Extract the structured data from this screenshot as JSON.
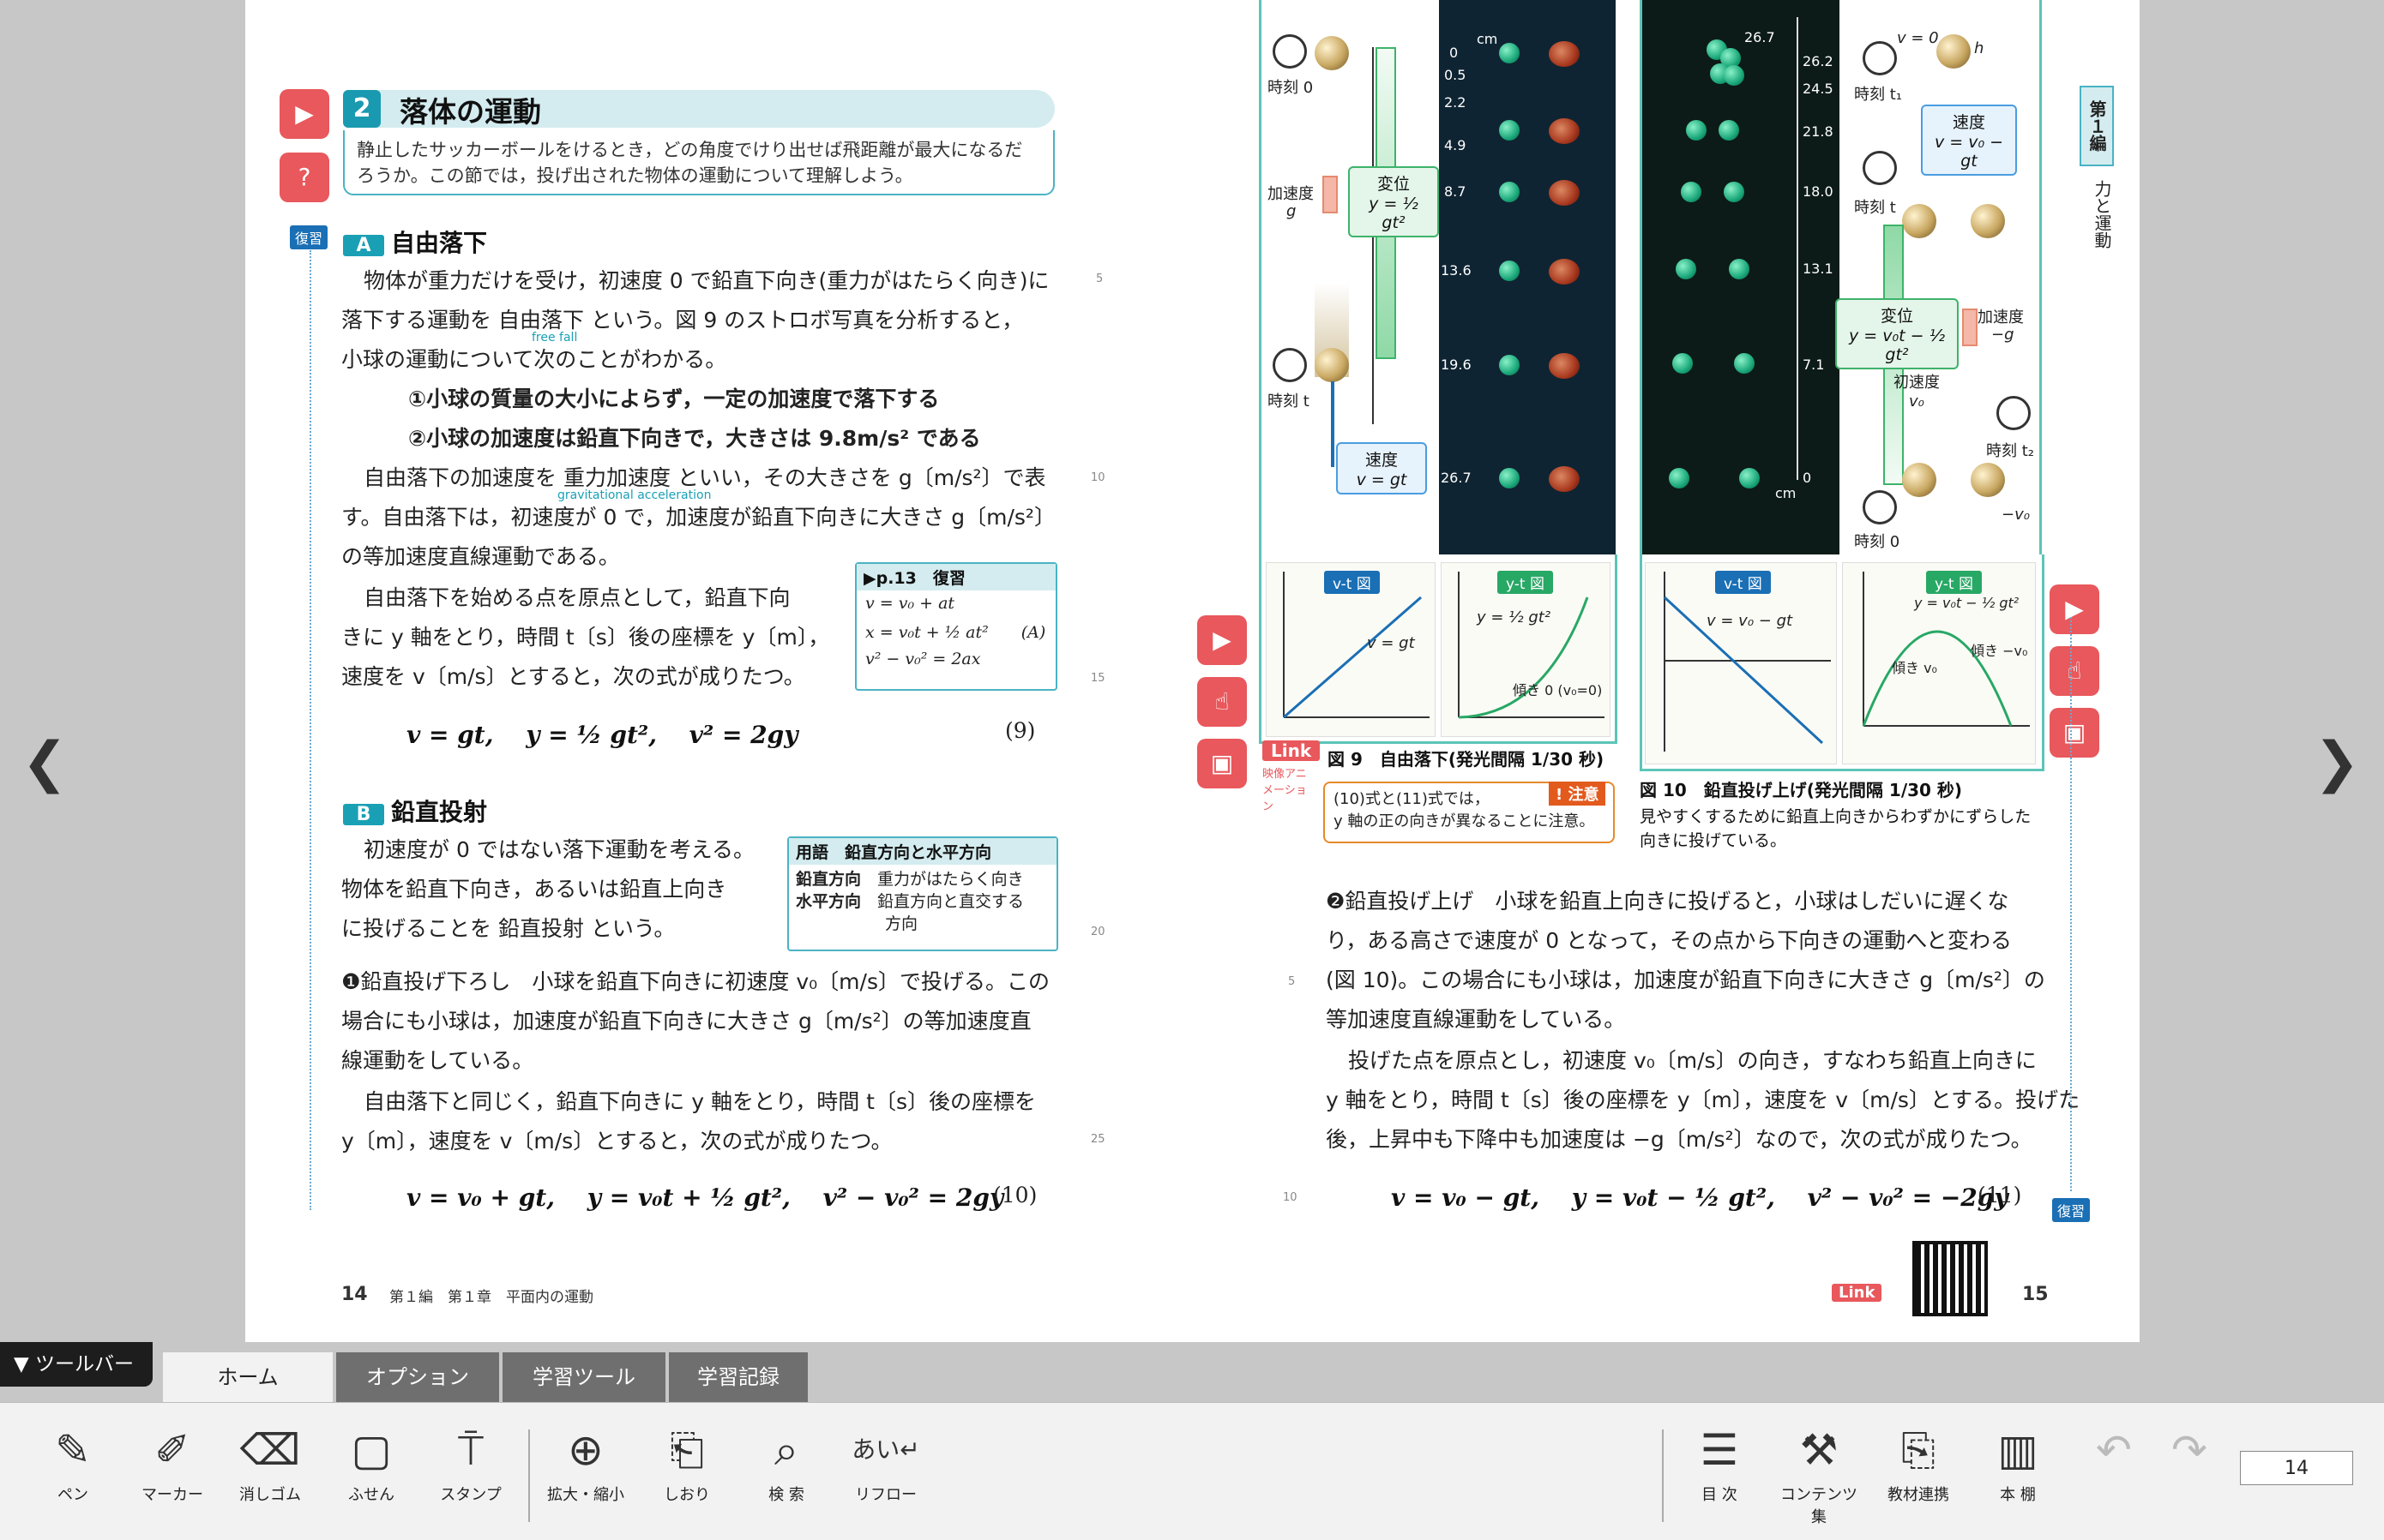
{
  "left_page": {
    "section_number": "2",
    "section_title": "落体の運動",
    "intro": [
      "静止したサッカーボールをけるとき，どの角度でけり出せば飛距離が最大になるだ",
      "ろうか。この節では，投げ出された物体の運動について理解しよう。"
    ],
    "review_tag": "復習",
    "subA_badge": "A",
    "subA_title": "自由落下",
    "paraA": [
      "物体が重力だけを受け，初速度 0 で鉛直下向き(重力がはたらく向き)に",
      "落下する運動を 自由落下 という。図 9 のストロボ写真を分析すると，",
      "小球の運動について次のことがわかる。",
      "①小球の質量の大小によらず，一定の加速度で落下する",
      "②小球の加速度は鉛直下向きで，大きさは 9.8m/s² である",
      "自由落下の加速度を 重力加速度 といい，その大きさを g〔m/s²〕で表",
      "す。自由落下は，初速度が 0 で，加速度が鉛直下向きに大きさ g〔m/s²〕",
      "の等加速度直線運動である。",
      "自由落下を始める点を原点として，鉛直下向",
      "きに y 軸をとり，時間 t〔s〕後の座標を y〔m〕，",
      "速度を v〔m/s〕とすると，次の式が成りたつ。"
    ],
    "ruby_free_fall": "free fall",
    "ruby_grav": "gravitational acceleration",
    "review_box": {
      "head": "▶p.13　復習",
      "l1": "v = v₀ + at",
      "l2": "x = v₀t + ½ at²　　(A)",
      "l3": "v² − v₀² = 2ax"
    },
    "eq9": "v = gt,　 y = ½ gt²,　 v² = 2gy",
    "eq9_num": "(9)",
    "subB_badge": "B",
    "subB_title": "鉛直投射",
    "paraB": [
      "初速度が 0 ではない落下運動を考える。",
      "物体を鉛直下向き，あるいは鉛直上向き",
      "に投げることを 鉛直投射 という。"
    ],
    "term_box": {
      "head": "用語　鉛直方向と水平方向",
      "r1a": "鉛直方向",
      "r1b": "重力がはたらく向き",
      "r2a": "水平方向",
      "r2b": "鉛直方向と直交する",
      "r2c": "方向"
    },
    "para1": [
      "❶鉛直投げ下ろし　小球を鉛直下向きに初速度 v₀〔m/s〕で投げる。この",
      "場合にも小球は，加速度が鉛直下向きに大きさ g〔m/s²〕の等加速度直",
      "線運動をしている。",
      "自由落下と同じく，鉛直下向きに y 軸をとり，時間 t〔s〕後の座標を",
      "y〔m〕，速度を v〔m/s〕とすると，次の式が成りたつ。"
    ],
    "eq10": "v = v₀ + gt,　 y = v₀t + ½ gt²,　 v² − v₀² = 2gy",
    "eq10_num": "(10)",
    "line_numbers": [
      "5",
      "10",
      "15",
      "20",
      "25"
    ],
    "page_no": "14",
    "footer": "第１編　第１章　平面内の運動"
  },
  "right_page": {
    "fig9": {
      "time0": "時刻 0",
      "timet": "時刻 t",
      "accel": "加速度",
      "g": "g",
      "disp": "変位",
      "disp_eq": "y = ½ gt²",
      "vel": "速度",
      "vel_eq": "v = gt",
      "cm": "cm",
      "ticks": [
        "0",
        "0.5",
        "2.2",
        "4.9",
        "8.7",
        "13.6",
        "19.6",
        "26.7"
      ],
      "vt_label": "v-t 図",
      "vt_eq": "v = gt",
      "yt_label": "y-t 図",
      "yt_eq": "y = ½ gt²",
      "yt_note": "傾き 0 (v₀=0)",
      "caption": "図 9　自由落下(発光間隔 1/30 秒)"
    },
    "fig10": {
      "ticks": [
        "26.7",
        "26.2",
        "24.5",
        "21.8",
        "18.0",
        "13.1",
        "7.1",
        "0"
      ],
      "cm": "cm",
      "v0": "v = 0",
      "t1": "時刻 t₁",
      "tt": "時刻 t",
      "t2": "時刻 t₂",
      "t0": "時刻 0",
      "vel": "速度",
      "vel_eq": "v = v₀ − gt",
      "disp": "変位",
      "disp_eq": "y = v₀t − ½ gt²",
      "init": "初速度",
      "init_v": "v₀",
      "accel": "加速度",
      "accel_v": "−g",
      "neg_v0": "−v₀",
      "h": "h",
      "vt_label": "v-t 図",
      "vt_eq": "v = v₀ − gt",
      "yt_label": "y-t 図",
      "yt_eq": "y = v₀t − ½ gt²",
      "slope1": "傾き v₀",
      "slope2": "傾き −v₀",
      "caption": "図 10　鉛直投げ上げ(発光間隔 1/30 秒)",
      "caption_sub": [
        "見やすくするために鉛直上向きからわずかにずらした",
        "向きに投げている。"
      ]
    },
    "link_label": "Link",
    "link_sub": "映像アニメーション",
    "note": {
      "tag": "! 注意",
      "l1": "(10)式と(11)式では，",
      "l2": "y 軸の正の向きが異なることに注意。"
    },
    "para2": [
      "❷鉛直投げ上げ　小球を鉛直上向きに投げると，小球はしだいに遅くな",
      "り，ある高さで速度が 0 となって，その点から下向きの運動へと変わる",
      "(図 10)。この場合にも小球は，加速度が鉛直下向きに大きさ g〔m/s²〕の",
      "等加速度直線運動をしている。",
      "投げた点を原点とし，初速度 v₀〔m/s〕の向き，すなわち鉛直上向きに",
      "y 軸をとり，時間 t〔s〕後の座標を y〔m〕，速度を v〔m/s〕とする。投げた",
      "後，上昇中も下降中も加速度は −g〔m/s²〕なので，次の式が成りたつ。"
    ],
    "eq11": "v = v₀ − gt,　 y = v₀t − ½ gt²,　 v² − v₀² = −2gy",
    "eq11_num": "(11)",
    "line_numbers": [
      "5",
      "10"
    ],
    "review_tag": "復習",
    "chapter_tab": "第１編",
    "chapter_side": "力と運動",
    "page_no": "15"
  },
  "toolbar": {
    "toggle": "▼ ツールバー",
    "tabs": [
      "ホーム",
      "オプション",
      "学習ツール",
      "学習記録"
    ],
    "tools_left": [
      "ペン",
      "マーカー",
      "消しゴム",
      "ふせん",
      "スタンプ",
      "拡大・縮小",
      "しおり",
      "検 索",
      "リフロー"
    ],
    "tools_right": [
      "目 次",
      "コンテンツ集",
      "教材連携",
      "本 棚"
    ],
    "page_value": "14",
    "icons_left": [
      "pen-icon",
      "marker-icon",
      "eraser-icon",
      "sticky-note-icon",
      "stamp-icon",
      "zoom-icon",
      "bookmark-icon",
      "search-icon",
      "reflow-icon"
    ],
    "icons_right": [
      "toc-icon",
      "contents-icon",
      "link-icon",
      "bookshelf-icon"
    ]
  },
  "colors": {
    "accent": "#1a9ab0",
    "red_icon": "#e8585c",
    "toolbar_bg": "#f2f2f2",
    "tab_dark": "#6f6f6f"
  }
}
